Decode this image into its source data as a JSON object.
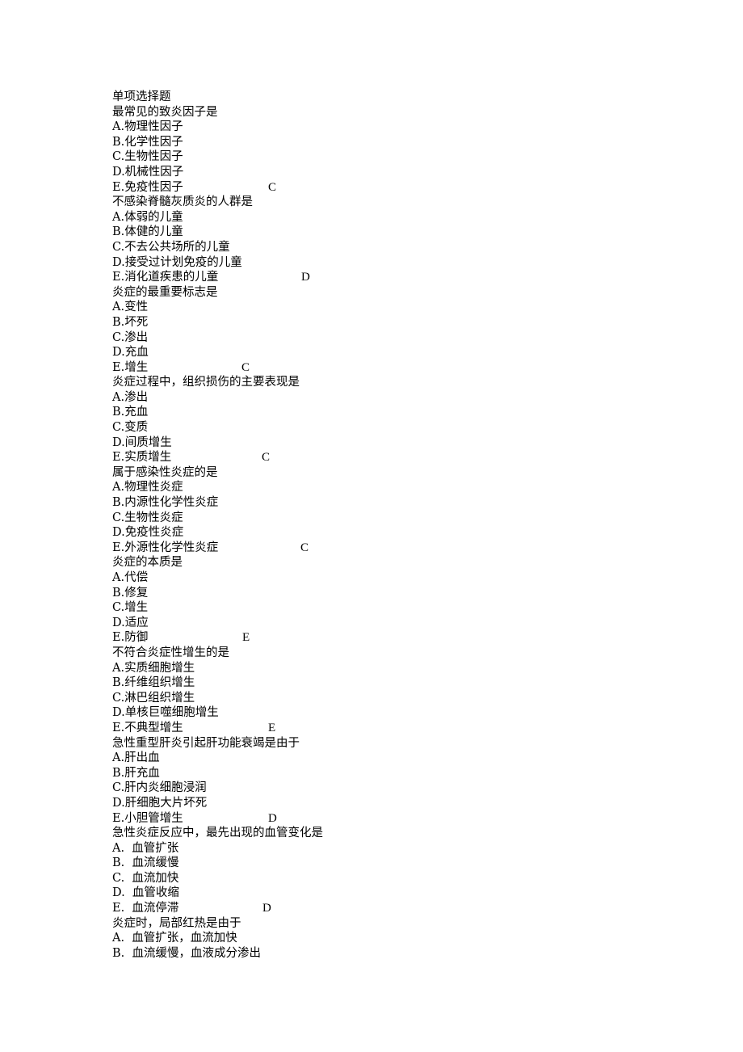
{
  "section_title": "单项选择题",
  "questions": [
    {
      "stem": "最常见的致炎因子是",
      "options": [
        "A.物理性因子",
        "B.化学性因子",
        "C.生物性因子",
        "D.机械性因子",
        "E.免疫性因子"
      ],
      "answer": "C"
    },
    {
      "stem": "不感染脊髓灰质炎的人群是",
      "options": [
        "A.体弱的儿童",
        "B.体健的儿童",
        "C.不去公共场所的儿童",
        "D.接受过计划免疫的儿童",
        "E.消化道疾患的儿童"
      ],
      "answer": "D"
    },
    {
      "stem": "炎症的最重要标志是",
      "options": [
        "A.变性",
        "B.坏死",
        "C.渗出",
        "D.充血",
        "E.增生"
      ],
      "answer": "C"
    },
    {
      "stem": "炎症过程中，组织损伤的主要表现是",
      "options": [
        "A.渗出",
        "B.充血",
        "C.变质",
        "D.间质增生",
        "E.实质增生"
      ],
      "answer": "C"
    },
    {
      "stem": "属于感染性炎症的是",
      "options": [
        "A.物理性炎症",
        "B.内源性化学性炎症",
        "C.生物性炎症",
        "D.免疫性炎症",
        "E.外源性化学性炎症"
      ],
      "answer": "C"
    },
    {
      "stem": "炎症的本质是",
      "options": [
        "A.代偿",
        "B.修复",
        "C.增生",
        "D.适应",
        "E.防御"
      ],
      "answer": "E"
    },
    {
      "stem": "不符合炎症性增生的是",
      "options": [
        "A.实质细胞增生",
        "B.纤维组织增生",
        "C.淋巴组织增生",
        "D.单核巨噬细胞增生",
        "E.不典型增生"
      ],
      "answer": "E"
    },
    {
      "stem": "急性重型肝炎引起肝功能衰竭是由于",
      "options": [
        "A.肝出血",
        "B.肝充血",
        "C.肝内炎细胞浸润",
        "D.肝细胞大片坏死",
        "E.小胆管增生"
      ],
      "answer": "D"
    },
    {
      "stem": "急性炎症反应中，最先出现的血管变化是",
      "options": [
        "A.  血管扩张",
        "B.  血流缓慢",
        "C.  血流加快",
        "D.  血管收缩",
        "E.  血流停滞"
      ],
      "answer": "D"
    },
    {
      "stem": "炎症时，局部红热是由于",
      "options": [
        "A.  血管扩张，血流加快",
        "B.  血流缓慢，血液成分渗出"
      ],
      "answer": null
    }
  ]
}
